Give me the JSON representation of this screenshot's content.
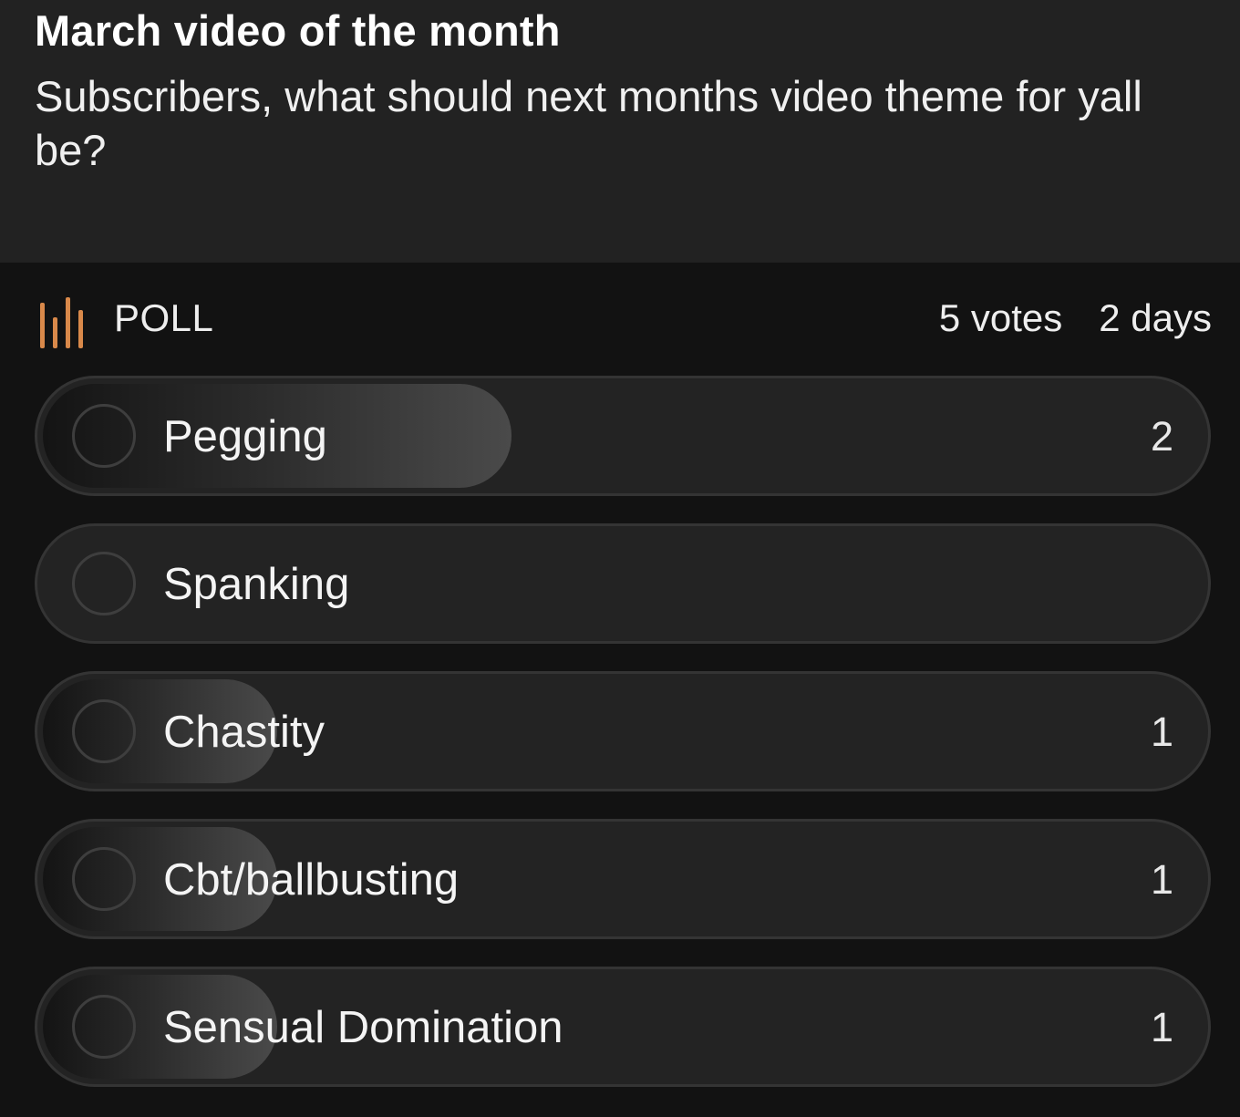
{
  "post": {
    "title": "March video of the month",
    "body": "Subscribers, what should next months video theme for yall be?"
  },
  "poll": {
    "icon": "poll-bars-icon",
    "accent_color": "#d9894a",
    "label": "POLL",
    "votes": "5 votes",
    "time_left": "2 days",
    "options": [
      {
        "label": "Pegging",
        "count": "2",
        "share": 0.4
      },
      {
        "label": "Spanking",
        "count": "",
        "share": 0
      },
      {
        "label": "Chastity",
        "count": "1",
        "share": 0.2
      },
      {
        "label": "Cbt/ballbusting",
        "count": "1",
        "share": 0.2
      },
      {
        "label": "Sensual Domination",
        "count": "1",
        "share": 0.2
      }
    ]
  }
}
